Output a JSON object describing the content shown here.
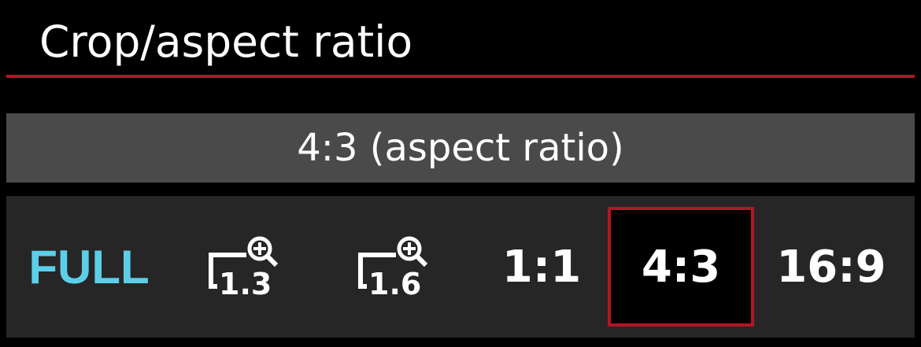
{
  "menu": {
    "title": "Crop/aspect ratio",
    "description": "4:3 (aspect ratio)",
    "accent_color": "#b11624",
    "full_color": "#5ccfe8",
    "selected_option": "4:3",
    "options": [
      {
        "label": "FULL",
        "icon": null
      },
      {
        "label": "1.3",
        "icon": "crop-zoom-icon"
      },
      {
        "label": "1.6",
        "icon": "crop-zoom-icon"
      },
      {
        "label": "1:1",
        "icon": null
      },
      {
        "label": "4:3",
        "icon": null
      },
      {
        "label": "16:9",
        "icon": null
      }
    ]
  }
}
